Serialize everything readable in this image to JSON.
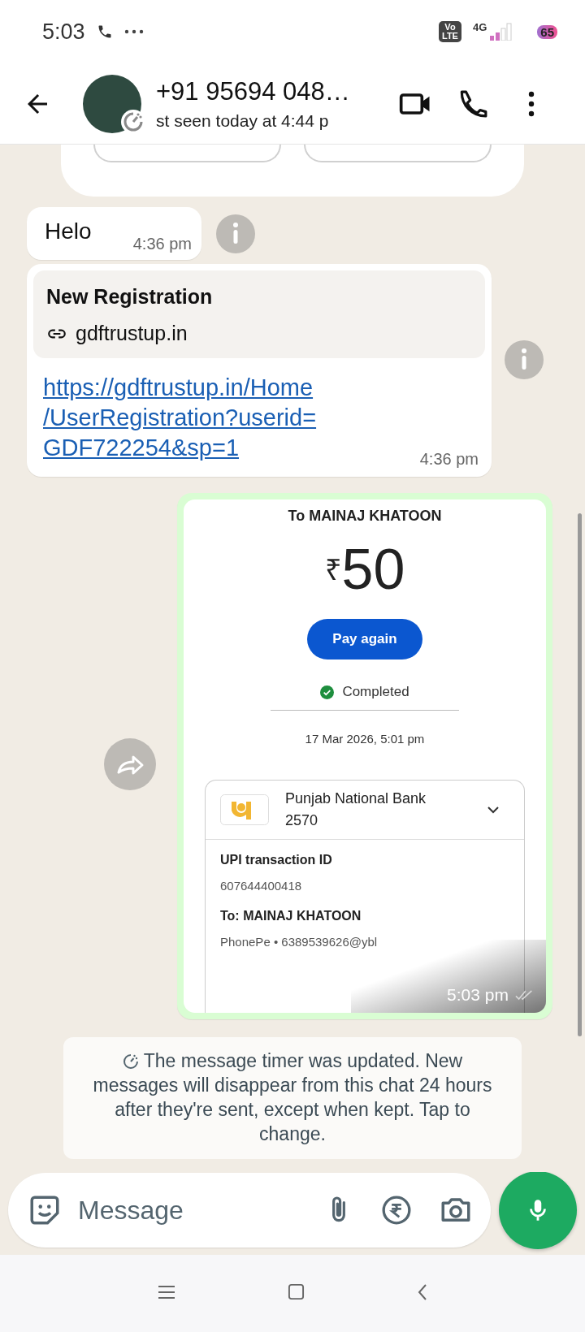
{
  "status_bar": {
    "time": "5:03",
    "volte": [
      "Vo",
      "LTE"
    ],
    "network": "4G",
    "battery": "65"
  },
  "header": {
    "contact_name": "+91 95694 048…",
    "last_seen": "st seen today at 4:44 p"
  },
  "messages": [
    {
      "kind": "partial_card"
    },
    {
      "kind": "text",
      "text": "Helo",
      "time": "4:36 pm"
    },
    {
      "kind": "link_preview",
      "title": "New Registration",
      "domain": "gdftrustup.in",
      "url_lines": [
        "https://gdftrustup.in/Home",
        "/UserRegistration?userid=",
        "GDF722254&sp=1"
      ],
      "time": "4:36 pm"
    },
    {
      "kind": "payment_image",
      "time": "5:03 pm",
      "receipt": {
        "recipient": "To MAINAJ KHATOON",
        "currency": "₹",
        "amount": "50",
        "button": "Pay again",
        "status": "Completed",
        "datetime": "17 Mar 2026, 5:01 pm",
        "bank": "Punjab National Bank",
        "account": "2570",
        "details": [
          {
            "label": "UPI transaction ID",
            "value": "607644400418"
          },
          {
            "label": "To: MAINAJ KHATOON",
            "value": "PhonePe • 6389539626@ybl"
          }
        ]
      }
    }
  ],
  "system_notice": "The message timer was updated. New messages will disappear from this chat 24 hours after they're sent, except when kept. Tap to change.",
  "composer": {
    "placeholder": "Message"
  }
}
